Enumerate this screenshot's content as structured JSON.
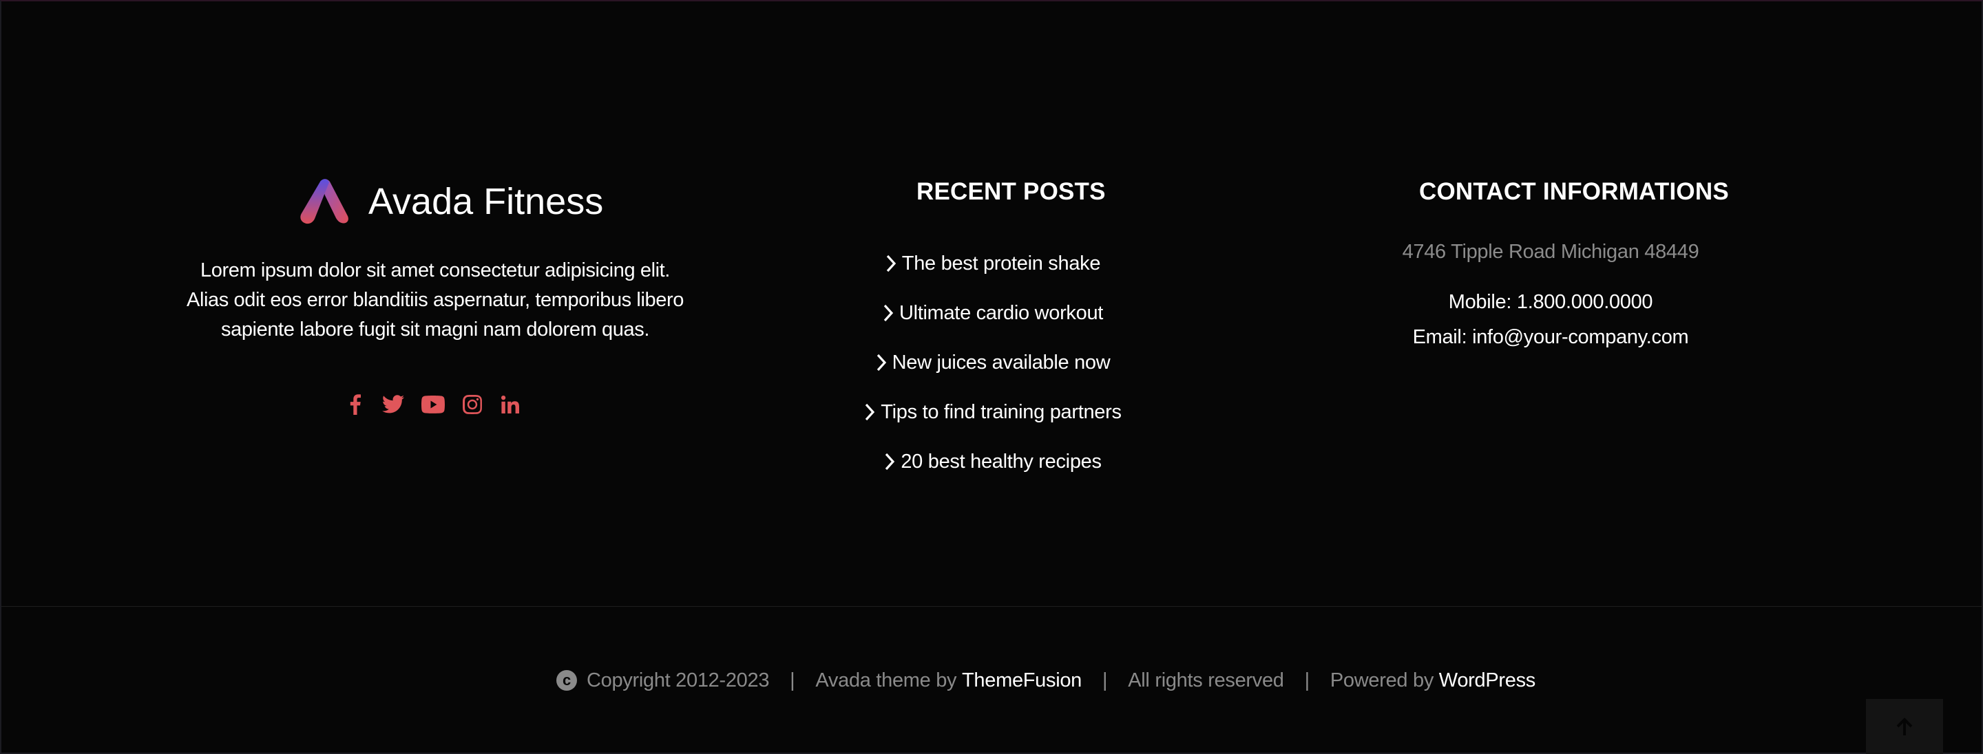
{
  "brand": {
    "name": "Avada Fitness",
    "logo_icon": "avada-a-logo-icon",
    "gradient": [
      "#6a4bd8",
      "#e0565a"
    ]
  },
  "about": {
    "text": "Lorem ipsum dolor sit amet consectetur adipisicing elit. Alias odit eos error blanditiis aspernatur, temporibus libero sapiente labore fugit sit magni nam dolorem quas."
  },
  "social": {
    "color": "#e0565a",
    "icons": [
      "facebook-icon",
      "twitter-icon",
      "youtube-icon",
      "instagram-icon",
      "linkedin-icon"
    ]
  },
  "recent_posts": {
    "title": "RECENT POSTS",
    "items": [
      "The best protein shake",
      "Ultimate cardio workout",
      "New juices available now",
      "Tips to find training partners",
      "20 best healthy recipes"
    ]
  },
  "contact": {
    "title": "CONTACT INFORMATIONS",
    "address": "4746 Tipple Road Michigan 48449",
    "mobile": "Mobile: 1.800.000.0000",
    "email": "Email: info@your-company.com"
  },
  "footer": {
    "copyright_symbol": "c",
    "copyright": "Copyright 2012-2023",
    "separator": "|",
    "theme_prefix": "Avada theme by",
    "theme_link": "ThemeFusion",
    "rights": "All rights reserved",
    "powered_prefix": "Powered by",
    "powered_link": "WordPress"
  },
  "to_top": {
    "icon": "arrow-up-icon"
  }
}
